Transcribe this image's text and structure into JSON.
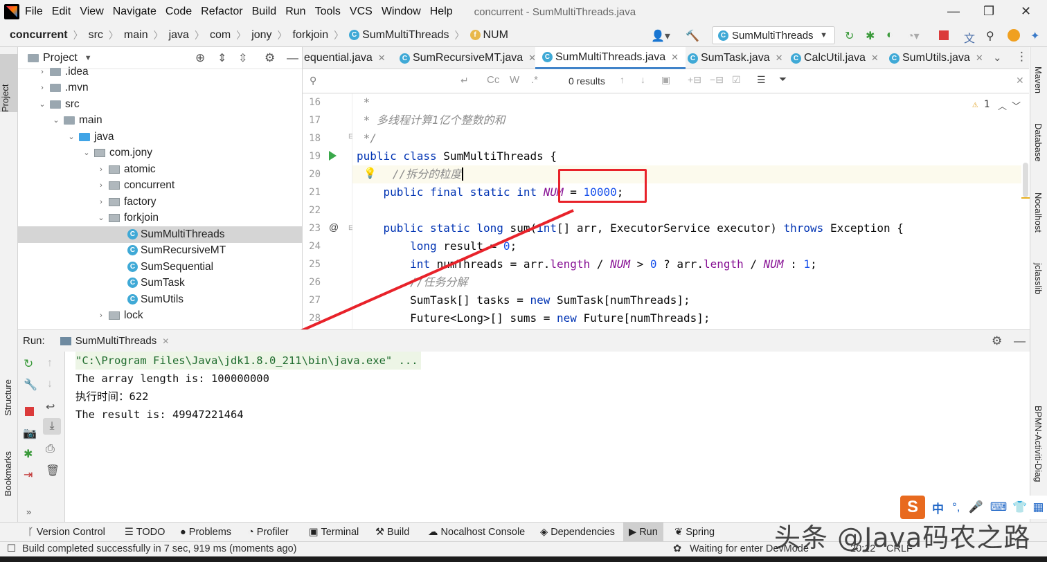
{
  "menubar": {
    "items": [
      "File",
      "Edit",
      "View",
      "Navigate",
      "Code",
      "Refactor",
      "Build",
      "Run",
      "Tools",
      "VCS",
      "Window",
      "Help"
    ],
    "window_title": "concurrent - SumMultiThreads.java"
  },
  "breadcrumbs": [
    "concurrent",
    "src",
    "main",
    "java",
    "com",
    "jony",
    "forkjoin",
    "SumMultiThreads",
    "NUM"
  ],
  "run_config": "SumMultiThreads",
  "project_panel": {
    "title": "Project",
    "tree": [
      ".idea",
      ".mvn",
      "src",
      "main",
      "java",
      "com.jony",
      "atomic",
      "concurrent",
      "factory",
      "forkjoin",
      "SumMultiThreads",
      "SumRecursiveMT",
      "SumSequential",
      "SumTask",
      "SumUtils",
      "lock"
    ]
  },
  "editor_tabs": [
    "equential.java",
    "SumRecursiveMT.java",
    "SumMultiThreads.java",
    "SumTask.java",
    "CalcUtil.java",
    "SumUtils.java"
  ],
  "findbar": {
    "results": "0 results"
  },
  "inspection": {
    "warnings": "1"
  },
  "code": {
    "line_numbers": [
      "16",
      "17",
      "18",
      "19",
      "20",
      "21",
      "22",
      "23",
      "24",
      "25",
      "26",
      "27",
      "28"
    ],
    "l16": " *",
    "l17": " * 多线程计算1亿个整数的和",
    "l18": " */",
    "l19_kw": "public class",
    "l19_rest": " SumMultiThreads {",
    "l20": "//拆分的粒度",
    "l21_kw": "public final static int",
    "l21_name": "NUM",
    "l21_eq": " = ",
    "l21_val": "10000",
    "l21_end": ";",
    "l23_kw": "public static long",
    "l23_name": " sum(",
    "l23_kw2": "int",
    "l23_mid": "[] arr, ExecutorService executor) ",
    "l23_kw3": "throws",
    "l23_end": " Exception {",
    "l24_kw": "long",
    "l24_mid": " result = ",
    "l24_val": "0",
    "l24_end": ";",
    "l25_kw": "int",
    "l25_a": " numThreads = arr.",
    "l25_f1": "length",
    "l25_b": " / ",
    "l25_s1": "NUM",
    "l25_c": " > ",
    "l25_v1": "0",
    "l25_d": " ? arr.",
    "l25_f2": "length",
    "l25_e": " / ",
    "l25_s2": "NUM",
    "l25_f": " : ",
    "l25_v2": "1",
    "l25_g": ";",
    "l26": "//任务分解",
    "l27_a": "SumTask[] tasks = ",
    "l27_kw": "new",
    "l27_b": " SumTask[numThreads];",
    "l28_a": "Future<Long>[] sums = ",
    "l28_kw": "new",
    "l28_b": " Future[numThreads];"
  },
  "run_panel": {
    "label": "Run:",
    "tab": "SumMultiThreads",
    "console": [
      "\"C:\\Program Files\\Java\\jdk1.8.0_211\\bin\\java.exe\" ...",
      "The array length is: 100000000",
      "执行时间：622",
      "The result is: 49947221464"
    ]
  },
  "left_stripe": [
    "Project",
    "Structure",
    "Bookmarks"
  ],
  "right_stripe": [
    "Maven",
    "Database",
    "Nocalhost",
    "jclasslib",
    "BPMN-Activiti-Diag"
  ],
  "bottom_tools": [
    "Version Control",
    "TODO",
    "Problems",
    "Profiler",
    "Terminal",
    "Build",
    "Nocalhost Console",
    "Dependencies",
    "Run",
    "Spring"
  ],
  "status": {
    "message": "Build completed successfully in 7 sec, 919 ms (moments ago)",
    "devmode": "Waiting for enter DevMode",
    "position": "20:12",
    "line_sep": "CRLF"
  },
  "watermark": "头条 @Java码农之路",
  "ime": {
    "lang": "中"
  },
  "colors": {
    "accent": "#4083c9",
    "annotation_red": "#e8222a",
    "keyword": "#0033b3",
    "static_field": "#871094",
    "number": "#1750eb"
  }
}
